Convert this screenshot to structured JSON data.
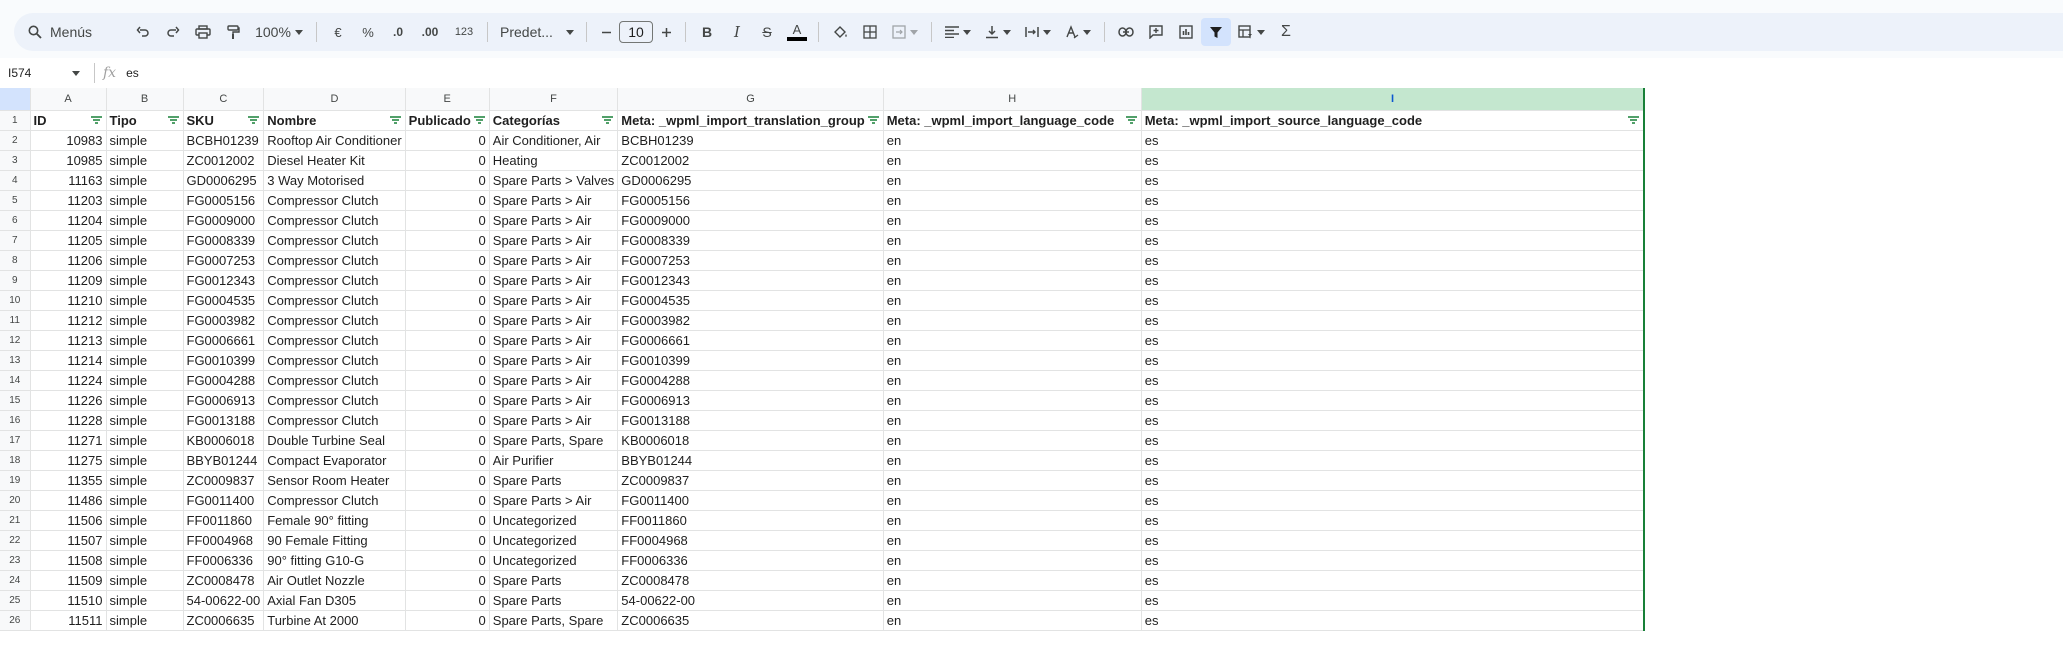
{
  "toolbar": {
    "search_label": "Menús",
    "zoom": "100%",
    "currency": "€",
    "percent": "%",
    "dec_less": ".0",
    "dec_more": ".00",
    "number_format": "123",
    "font": "Predet...",
    "font_size": "10"
  },
  "formula_bar": {
    "cell_ref": "I574",
    "fx": "fx",
    "value": "es"
  },
  "columns": [
    "A",
    "B",
    "C",
    "D",
    "E",
    "F",
    "G",
    "H",
    "I"
  ],
  "headers": [
    "ID",
    "Tipo",
    "SKU",
    "Nombre",
    "Publicado",
    "Categorías",
    "Meta: _wpml_import_translation_group",
    "Meta: _wpml_import_language_code",
    "Meta: _wpml_import_source_language_code"
  ],
  "rows": [
    {
      "n": "2",
      "id": "10983",
      "tipo": "simple",
      "sku": "BCBH01239",
      "nombre": "Rooftop Air Conditioner",
      "pub": "0",
      "cat": "Air Conditioner, Air",
      "g": "BCBH01239",
      "h": "en",
      "i": "es"
    },
    {
      "n": "3",
      "id": "10985",
      "tipo": "simple",
      "sku": "ZC0012002",
      "nombre": "Diesel Heater Kit",
      "pub": "0",
      "cat": "Heating",
      "g": "ZC0012002",
      "h": "en",
      "i": "es"
    },
    {
      "n": "4",
      "id": "11163",
      "tipo": "simple",
      "sku": "GD0006295",
      "nombre": "3 Way Motorised",
      "pub": "0",
      "cat": "Spare Parts > Valves",
      "g": "GD0006295",
      "h": "en",
      "i": "es"
    },
    {
      "n": "5",
      "id": "11203",
      "tipo": "simple",
      "sku": "FG0005156",
      "nombre": "Compressor Clutch",
      "pub": "0",
      "cat": "Spare Parts > Air",
      "g": "FG0005156",
      "h": "en",
      "i": "es"
    },
    {
      "n": "6",
      "id": "11204",
      "tipo": "simple",
      "sku": "FG0009000",
      "nombre": "Compressor Clutch",
      "pub": "0",
      "cat": "Spare Parts > Air",
      "g": "FG0009000",
      "h": "en",
      "i": "es"
    },
    {
      "n": "7",
      "id": "11205",
      "tipo": "simple",
      "sku": "FG0008339",
      "nombre": "Compressor Clutch",
      "pub": "0",
      "cat": "Spare Parts > Air",
      "g": "FG0008339",
      "h": "en",
      "i": "es"
    },
    {
      "n": "8",
      "id": "11206",
      "tipo": "simple",
      "sku": "FG0007253",
      "nombre": "Compressor Clutch",
      "pub": "0",
      "cat": "Spare Parts > Air",
      "g": "FG0007253",
      "h": "en",
      "i": "es"
    },
    {
      "n": "9",
      "id": "11209",
      "tipo": "simple",
      "sku": "FG0012343",
      "nombre": "Compressor Clutch",
      "pub": "0",
      "cat": "Spare Parts > Air",
      "g": "FG0012343",
      "h": "en",
      "i": "es"
    },
    {
      "n": "10",
      "id": "11210",
      "tipo": "simple",
      "sku": "FG0004535",
      "nombre": "Compressor Clutch",
      "pub": "0",
      "cat": "Spare Parts > Air",
      "g": "FG0004535",
      "h": "en",
      "i": "es"
    },
    {
      "n": "11",
      "id": "11212",
      "tipo": "simple",
      "sku": "FG0003982",
      "nombre": "Compressor Clutch",
      "pub": "0",
      "cat": "Spare Parts > Air",
      "g": "FG0003982",
      "h": "en",
      "i": "es"
    },
    {
      "n": "12",
      "id": "11213",
      "tipo": "simple",
      "sku": "FG0006661",
      "nombre": "Compressor Clutch",
      "pub": "0",
      "cat": "Spare Parts > Air",
      "g": "FG0006661",
      "h": "en",
      "i": "es"
    },
    {
      "n": "13",
      "id": "11214",
      "tipo": "simple",
      "sku": "FG0010399",
      "nombre": "Compressor Clutch",
      "pub": "0",
      "cat": "Spare Parts > Air",
      "g": "FG0010399",
      "h": "en",
      "i": "es"
    },
    {
      "n": "14",
      "id": "11224",
      "tipo": "simple",
      "sku": "FG0004288",
      "nombre": "Compressor Clutch",
      "pub": "0",
      "cat": "Spare Parts > Air",
      "g": "FG0004288",
      "h": "en",
      "i": "es"
    },
    {
      "n": "15",
      "id": "11226",
      "tipo": "simple",
      "sku": "FG0006913",
      "nombre": "Compressor Clutch",
      "pub": "0",
      "cat": "Spare Parts > Air",
      "g": "FG0006913",
      "h": "en",
      "i": "es"
    },
    {
      "n": "16",
      "id": "11228",
      "tipo": "simple",
      "sku": "FG0013188",
      "nombre": "Compressor Clutch",
      "pub": "0",
      "cat": "Spare Parts > Air",
      "g": "FG0013188",
      "h": "en",
      "i": "es"
    },
    {
      "n": "17",
      "id": "11271",
      "tipo": "simple",
      "sku": "KB0006018",
      "nombre": "Double Turbine Seal",
      "pub": "0",
      "cat": "Spare Parts, Spare",
      "g": "KB0006018",
      "h": "en",
      "i": "es"
    },
    {
      "n": "18",
      "id": "11275",
      "tipo": "simple",
      "sku": "BBYB01244",
      "nombre": "Compact Evaporator",
      "pub": "0",
      "cat": "Air Purifier",
      "g": "BBYB01244",
      "h": "en",
      "i": "es"
    },
    {
      "n": "19",
      "id": "11355",
      "tipo": "simple",
      "sku": "ZC0009837",
      "nombre": "Sensor Room Heater",
      "pub": "0",
      "cat": "Spare Parts",
      "g": "ZC0009837",
      "h": "en",
      "i": "es"
    },
    {
      "n": "20",
      "id": "11486",
      "tipo": "simple",
      "sku": "FG0011400",
      "nombre": "Compressor Clutch",
      "pub": "0",
      "cat": "Spare Parts > Air",
      "g": "FG0011400",
      "h": "en",
      "i": "es"
    },
    {
      "n": "21",
      "id": "11506",
      "tipo": "simple",
      "sku": "FF0011860",
      "nombre": "Female 90° fitting",
      "pub": "0",
      "cat": "Uncategorized",
      "g": "FF0011860",
      "h": "en",
      "i": "es"
    },
    {
      "n": "22",
      "id": "11507",
      "tipo": "simple",
      "sku": "FF0004968",
      "nombre": "90 Female Fitting",
      "pub": "0",
      "cat": "Uncategorized",
      "g": "FF0004968",
      "h": "en",
      "i": "es"
    },
    {
      "n": "23",
      "id": "11508",
      "tipo": "simple",
      "sku": "FF0006336",
      "nombre": "90° fitting G10-G",
      "pub": "0",
      "cat": "Uncategorized",
      "g": "FF0006336",
      "h": "en",
      "i": "es"
    },
    {
      "n": "24",
      "id": "11509",
      "tipo": "simple",
      "sku": "ZC0008478",
      "nombre": "Air Outlet Nozzle",
      "pub": "0",
      "cat": "Spare Parts",
      "g": "ZC0008478",
      "h": "en",
      "i": "es"
    },
    {
      "n": "25",
      "id": "11510",
      "tipo": "simple",
      "sku": "54-00622-00",
      "nombre": "Axial Fan D305",
      "pub": "0",
      "cat": "Spare Parts",
      "g": "54-00622-00",
      "h": "en",
      "i": "es"
    },
    {
      "n": "26",
      "id": "11511",
      "tipo": "simple",
      "sku": "ZC0006635",
      "nombre": "Turbine At 2000",
      "pub": "0",
      "cat": "Spare Parts, Spare",
      "g": "ZC0006635",
      "h": "en",
      "i": "es"
    }
  ]
}
